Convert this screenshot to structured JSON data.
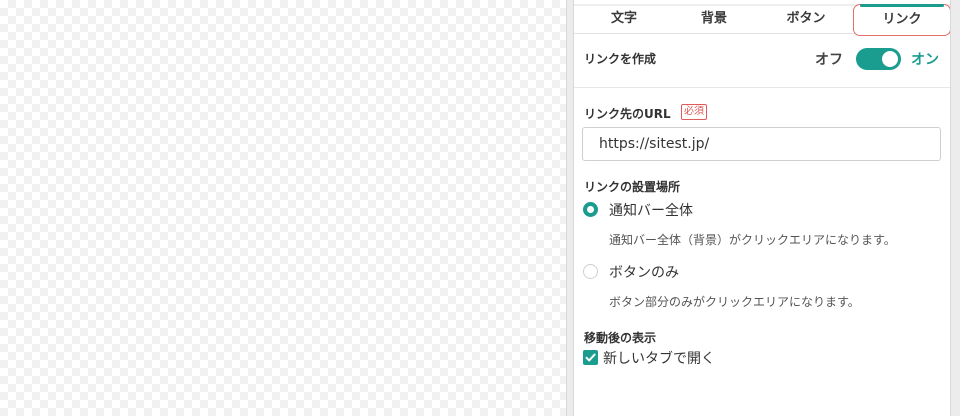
{
  "tabs": [
    {
      "label": "文字"
    },
    {
      "label": "背景"
    },
    {
      "label": "ボタン"
    },
    {
      "label": "リンク",
      "active": true
    }
  ],
  "link_toggle": {
    "label": "リンクを作成",
    "off_label": "オフ",
    "on_label": "オン",
    "state": "on"
  },
  "url": {
    "label": "リンク先のURL",
    "required_badge": "必須",
    "value": "https://sitest.jp/"
  },
  "placement": {
    "label": "リンクの設置場所",
    "options": [
      {
        "label": "通知バー全体",
        "description": "通知バー全体（背景）がクリックエリアになります。",
        "checked": true
      },
      {
        "label": "ボタンのみ",
        "description": "ボタン部分のみがクリックエリアになります。",
        "checked": false
      }
    ]
  },
  "after_move": {
    "label": "移動後の表示",
    "checkbox_label": "新しいタブで開く",
    "checked": true
  },
  "colors": {
    "accent": "#1a9c8f",
    "active_tab_outline": "#e36f6a",
    "required": "#e05a5a"
  },
  "icons": {
    "checkbox": "checkmark-icon"
  }
}
